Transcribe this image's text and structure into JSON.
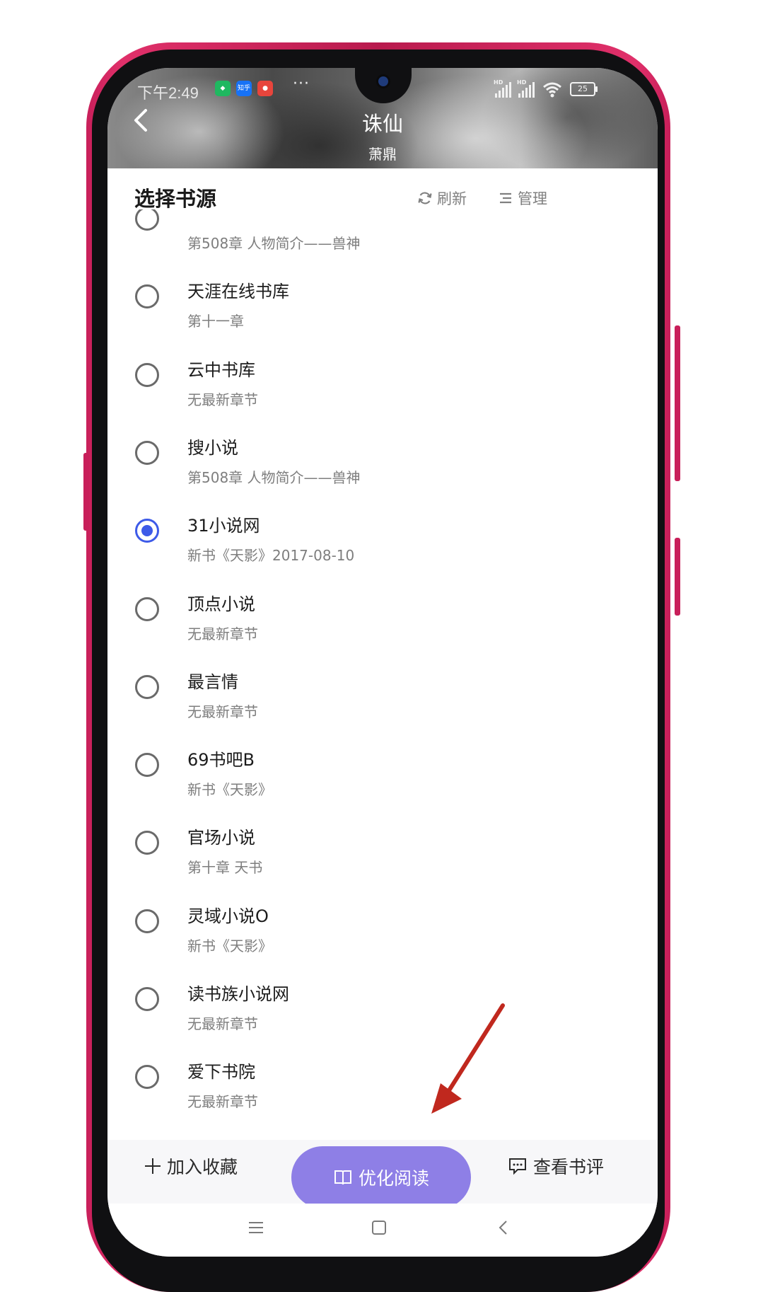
{
  "status_bar": {
    "time": "下午2:49",
    "apps": [
      "green-shield-icon",
      "知乎",
      "red-app-icon"
    ],
    "more": "···",
    "signal1_label": "HD",
    "signal2_label": "HD",
    "battery": "25"
  },
  "header": {
    "title": "诛仙",
    "author": "萧鼎"
  },
  "panel": {
    "title": "选择书源",
    "refresh_label": "刷新",
    "manage_label": "管理"
  },
  "sources": [
    {
      "name": "",
      "latest": "第508章 人物简介——兽神",
      "selected": false
    },
    {
      "name": "天涯在线书库",
      "latest": "第十一章",
      "selected": false
    },
    {
      "name": "云中书库",
      "latest": "无最新章节",
      "selected": false
    },
    {
      "name": "搜小说",
      "latest": "第508章 人物简介——兽神",
      "selected": false
    },
    {
      "name": "31小说网",
      "latest": "新书《天影》2017-08-10",
      "selected": true
    },
    {
      "name": "顶点小说",
      "latest": "无最新章节",
      "selected": false
    },
    {
      "name": "最言情",
      "latest": "无最新章节",
      "selected": false
    },
    {
      "name": "69书吧B",
      "latest": "新书《天影》",
      "selected": false
    },
    {
      "name": "官场小说",
      "latest": "第十章 天书",
      "selected": false
    },
    {
      "name": "灵域小说O",
      "latest": "新书《天影》",
      "selected": false
    },
    {
      "name": "读书族小说网",
      "latest": "无最新章节",
      "selected": false
    },
    {
      "name": "爱下书院",
      "latest": "无最新章节",
      "selected": false
    }
  ],
  "bottom_actions": {
    "add_favorite": "加入收藏",
    "optimized_read": "优化阅读",
    "view_reviews": "查看书评"
  },
  "colors": {
    "accent_blue": "#3d5ae8",
    "button_purple": "#8e7fe6",
    "phone_frame": "#c81f5a",
    "annotation_arrow": "#c0281e"
  }
}
